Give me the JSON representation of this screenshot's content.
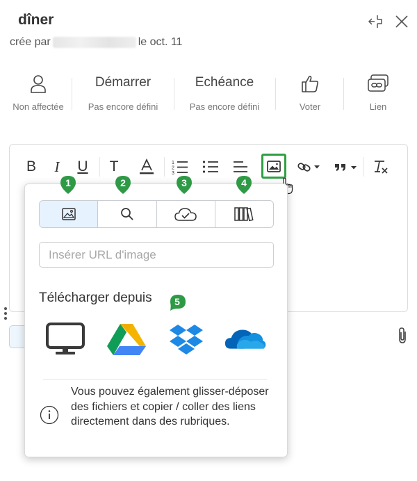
{
  "header": {
    "title": "dîner",
    "created_prefix": "crée par",
    "created_suffix": "le oct. 11",
    "icons": [
      "collapse-panel-icon",
      "close-icon"
    ]
  },
  "meta": {
    "assignee": {
      "label": "Non affectée",
      "icon": "user-icon"
    },
    "start": {
      "title": "Démarrer",
      "label": "Pas encore défini"
    },
    "due": {
      "title": "Echéance",
      "label": "Pas encore défini"
    },
    "vote": {
      "label": "Voter",
      "icon": "thumbs-up-icon"
    },
    "link": {
      "label": "Lien",
      "icon": "link-cards-icon"
    }
  },
  "toolbar": {
    "bold": "B",
    "italic": "I",
    "underline": "U",
    "text_size": "T",
    "active_tool": "insert-image"
  },
  "image_popup": {
    "tabs": [
      "image-icon",
      "search-icon",
      "cloud-icon",
      "library-icon"
    ],
    "active_tab": 0,
    "url_placeholder": "Insérer URL d'image",
    "upload_title": "Télécharger depuis",
    "sources": [
      "computer-icon",
      "google-drive-icon",
      "dropbox-icon",
      "onedrive-icon"
    ],
    "info_text": "Vous pouvez également glisser-déposer des fichiers et copier / coller des liens directement dans des rubriques."
  },
  "markers": [
    "1",
    "2",
    "3",
    "4",
    "5"
  ],
  "colors": {
    "marker_green": "#2e9a46",
    "active_border": "#2ea043",
    "active_tab_bg": "#e6f2fd"
  }
}
